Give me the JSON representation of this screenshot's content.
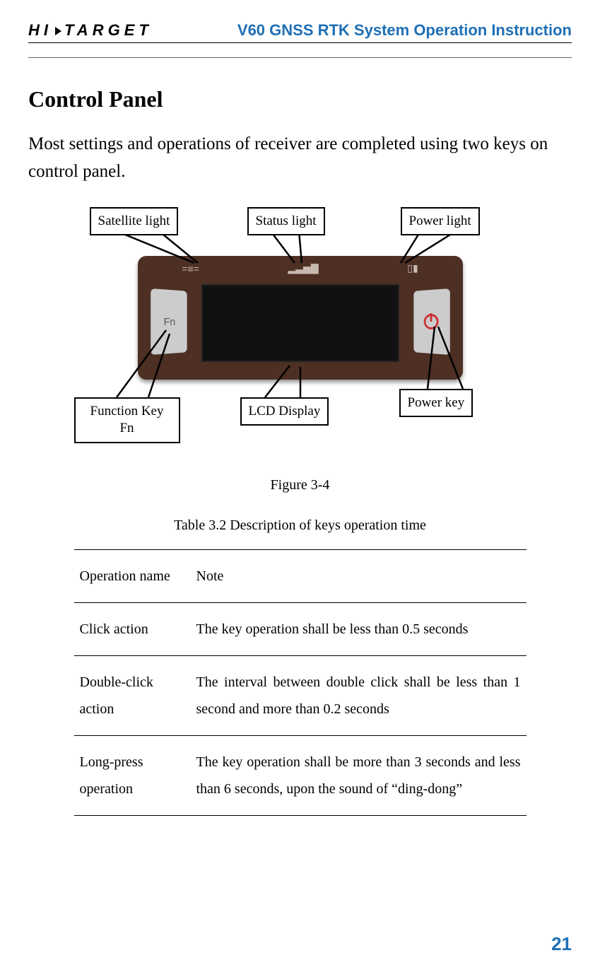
{
  "header": {
    "logo_pre": "HI",
    "logo_post": "TARGET",
    "doc_title": "V60 GNSS RTK System Operation Instruction"
  },
  "section": {
    "heading": "Control Panel",
    "intro": "Most settings and operations of receiver are completed using two keys on control panel."
  },
  "diagram": {
    "callouts": {
      "satellite": "Satellite light",
      "status": "Status light",
      "power_light": "Power light",
      "fn_key_line1": "Function Key",
      "fn_key_line2": "Fn",
      "lcd": "LCD Display",
      "power_key": "Power key"
    },
    "caption": "Figure 3-4"
  },
  "table": {
    "caption": "Table 3.2 Description of keys operation time",
    "headers": {
      "op": "Operation name",
      "note": "Note"
    },
    "rows": [
      {
        "op": "Click action",
        "note": "The key operation shall be less than 0.5 seconds"
      },
      {
        "op": "Double-click action",
        "note": "The interval between double click shall be less than 1 second and more than 0.2 seconds"
      },
      {
        "op": "Long-press operation",
        "note": "The key operation shall be more than 3 seconds and less than 6 seconds, upon the sound of “ding-dong”"
      }
    ]
  },
  "page_number": "21"
}
